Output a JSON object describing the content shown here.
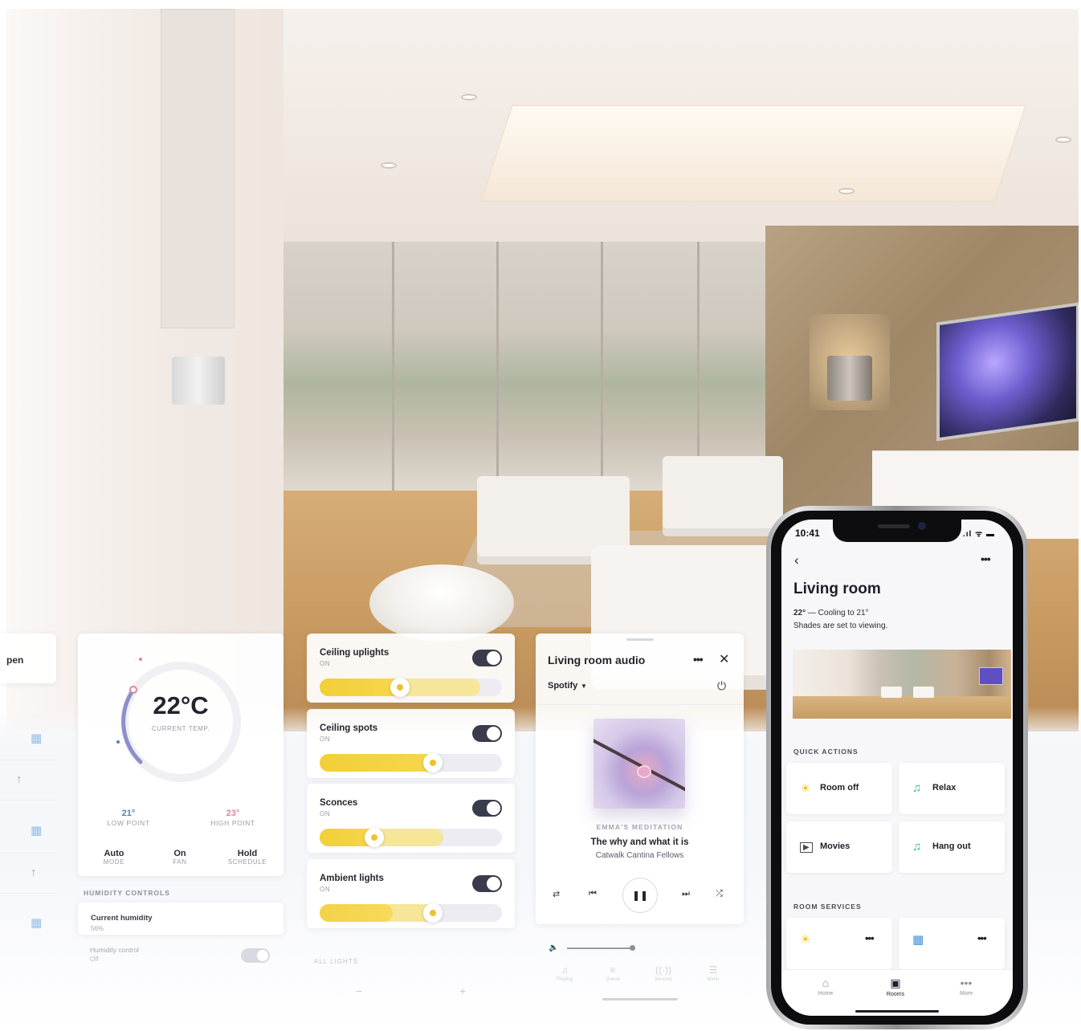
{
  "open_card": {
    "label": "pen"
  },
  "thermostat": {
    "current_temp": "22°C",
    "current_label": "CURRENT TEMP.",
    "low": {
      "value": "21°",
      "label": "LOW POINT"
    },
    "high": {
      "value": "23°",
      "label": "HIGH POINT"
    },
    "modes": [
      {
        "value": "Auto",
        "label": "MODE"
      },
      {
        "value": "On",
        "label": "FAN"
      },
      {
        "value": "Hold",
        "label": "SCHEDULE"
      }
    ],
    "humidity_title": "HUMIDITY CONTROLS",
    "current_humidity_label": "Current humidity",
    "current_humidity_value": "56%",
    "humidity_control_label": "Humidity control",
    "humidity_control_value": "Off",
    "colors": {
      "low": "#5b78c8",
      "high": "#d98a96",
      "arc": "#7f86c9"
    }
  },
  "lights": {
    "items": [
      {
        "name": "Ceiling uplights",
        "state": "ON",
        "level": 0.44
      },
      {
        "name": "Ceiling spots",
        "state": "ON",
        "level": 0.62
      },
      {
        "name": "Sconces",
        "state": "ON",
        "level": 0.3
      },
      {
        "name": "Ambient lights",
        "state": "ON",
        "level": 0.62
      }
    ],
    "all_label": "ALL LIGHTS",
    "minus": "−",
    "plus": "+",
    "accent": "#f2cf38"
  },
  "audio": {
    "title": "Living room audio",
    "more": "•••",
    "close": "✕",
    "source": "Spotify",
    "artist": "EMMA'S MEDITATION",
    "song": "The why and what it is",
    "album": "Catwalk Cantina Fellows",
    "volume": 0.95,
    "tabs": [
      {
        "icon": "♫",
        "label": "Playing"
      },
      {
        "icon": "≡",
        "label": "Queue"
      },
      {
        "icon": "((·))",
        "label": "Sources"
      },
      {
        "icon": "☰",
        "label": "Menu"
      }
    ]
  },
  "phone": {
    "time": "10:41",
    "status_icons": ".ıl ᯤ ▬",
    "back": "‹",
    "more": "•••",
    "title": "Living room",
    "temp_bold": "22°",
    "temp_text": " — Cooling to 21°",
    "shades": "Shades are set to viewing.",
    "quick_actions_title": "QUICK ACTIONS",
    "quick_actions": [
      {
        "label": "Room off",
        "icon": "sun-icon",
        "glyph": "☀",
        "color": "#f2c21c"
      },
      {
        "label": "Relax",
        "icon": "music-note-icon",
        "glyph": "♫",
        "color": "#39b48a"
      },
      {
        "label": "Movies",
        "icon": "screen-play-icon",
        "glyph": "▶",
        "color": "#4a4a58"
      },
      {
        "label": "Hang out",
        "icon": "music-note-icon",
        "glyph": "♫",
        "color": "#39b48a"
      }
    ],
    "room_services_title": "ROOM SERVICES",
    "room_services": [
      {
        "icon": "sun-icon",
        "glyph": "☀",
        "color": "#f2c21c",
        "more": "•••"
      },
      {
        "icon": "window-shade-icon",
        "glyph": "▦",
        "color": "#3f8ed6",
        "more": "•••"
      }
    ],
    "tabs": [
      {
        "label": "Home",
        "glyph": "⌂"
      },
      {
        "label": "Rooms",
        "glyph": "▣"
      },
      {
        "label": "More",
        "glyph": "•••"
      }
    ],
    "active_tab": "Rooms"
  }
}
